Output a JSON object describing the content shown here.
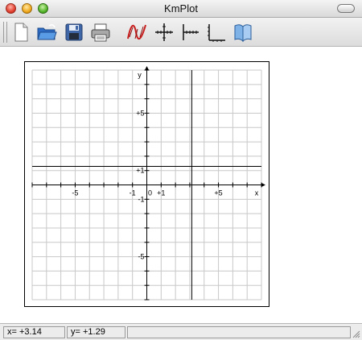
{
  "window": {
    "title": "KmPlot"
  },
  "toolbar": {
    "buttons": [
      {
        "name": "new-button",
        "icon": "new-document-icon"
      },
      {
        "name": "open-button",
        "icon": "open-folder-icon"
      },
      {
        "name": "save-button",
        "icon": "save-floppy-icon"
      },
      {
        "name": "print-button",
        "icon": "printer-icon"
      },
      {
        "name": "edit-plots-button",
        "icon": "function-curve-icon"
      },
      {
        "name": "trace-button",
        "icon": "crosshair-icon"
      },
      {
        "name": "coordinate-system-button",
        "icon": "axes-ticks-icon"
      },
      {
        "name": "scaling-button",
        "icon": "scale-icon"
      },
      {
        "name": "help-button",
        "icon": "book-icon"
      }
    ]
  },
  "chart_data": {
    "type": "line",
    "xlabel": "x",
    "ylabel": "y",
    "xlim": [
      -8,
      8
    ],
    "ylim": [
      -8,
      8
    ],
    "grid": true,
    "x_tick_labels": [
      "-5",
      "-1",
      "+1",
      "+5"
    ],
    "y_tick_labels": [
      "+5",
      "+1",
      "-1",
      "-5"
    ],
    "origin_label": "0",
    "series": [
      {
        "kind": "vertical",
        "x": 3.14
      },
      {
        "kind": "horizontal",
        "y": 1.29
      }
    ]
  },
  "status": {
    "x": "x= +3.14",
    "y": "y= +1.29"
  }
}
